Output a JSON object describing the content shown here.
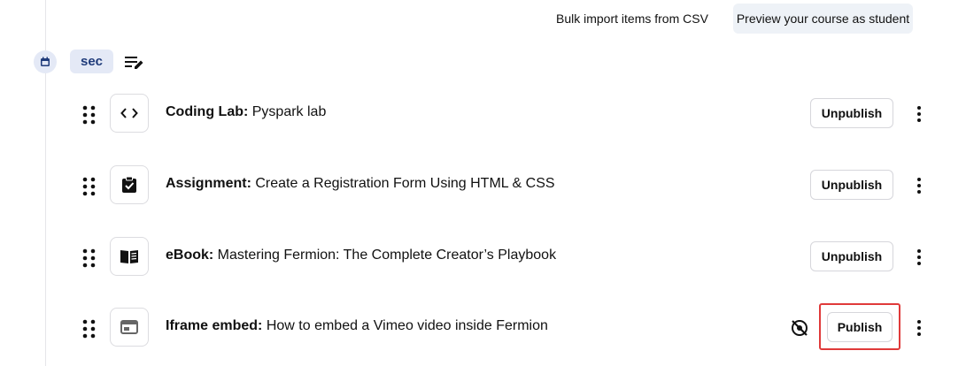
{
  "header": {
    "bulk_import_label": "Bulk import items from CSV",
    "preview_label": "Preview your course as student"
  },
  "section": {
    "chip_label": "sec",
    "icon": "calendar-icon",
    "edit_icon": "edit-list-icon"
  },
  "items": [
    {
      "type_label": "Coding Lab:",
      "title": " Pyspark lab",
      "icon": "code-icon",
      "action_label": "Unpublish"
    },
    {
      "type_label": "Assignment:",
      "title": " Create a Registration Form Using HTML & CSS",
      "icon": "clipboard-check-icon",
      "action_label": "Unpublish"
    },
    {
      "type_label": "eBook:",
      "title": " Mastering Fermion: The Complete Creator’s Playbook",
      "icon": "book-open-icon",
      "action_label": "Unpublish"
    },
    {
      "type_label": "Iframe embed:",
      "title": " How to embed a Vimeo video inside Fermion",
      "icon": "iframe-icon",
      "action_label": "Publish",
      "hidden_icon": "eye-off-icon"
    }
  ],
  "colors": {
    "accent": "#1f3b7a",
    "chip_bg": "#e4e9f6",
    "highlight": "#e03a3a"
  }
}
